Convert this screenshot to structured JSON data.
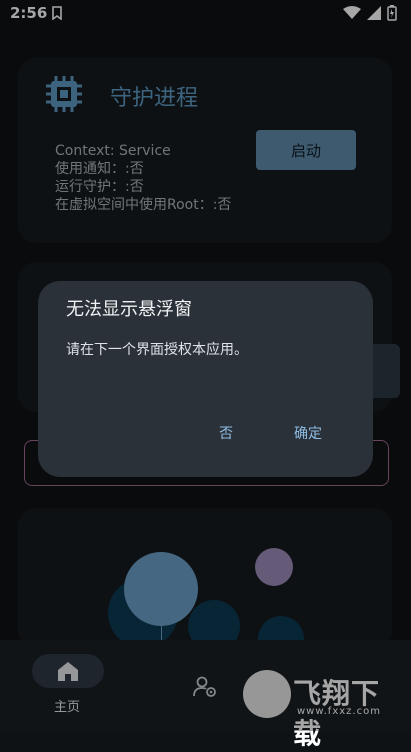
{
  "status_bar": {
    "time": "2:56"
  },
  "guard_card": {
    "title": "守护进程",
    "icon": "chip-icon",
    "info_lines": [
      "Context: Service",
      "使用通知：:否",
      "运行守护：:否",
      "在虚拟空间中使用Root：:否"
    ],
    "start_button": "启动"
  },
  "dialog": {
    "title": "无法显示悬浮窗",
    "message": "请在下一个界面授权本应用。",
    "negative": "否",
    "positive": "确定"
  },
  "bottom_nav": {
    "items": [
      {
        "label": "主页",
        "icon": "home-icon",
        "selected": true
      },
      {
        "label": "",
        "icon": "user-settings-icon",
        "selected": false
      }
    ]
  },
  "watermark": {
    "text": "飞翔下载",
    "url": "www.fxxz.com"
  },
  "colors": {
    "accent": "#5e9ac3",
    "button": "#5e8bab",
    "background": "#0f1215",
    "card": "#161b20",
    "dialog": "#2a3139"
  }
}
